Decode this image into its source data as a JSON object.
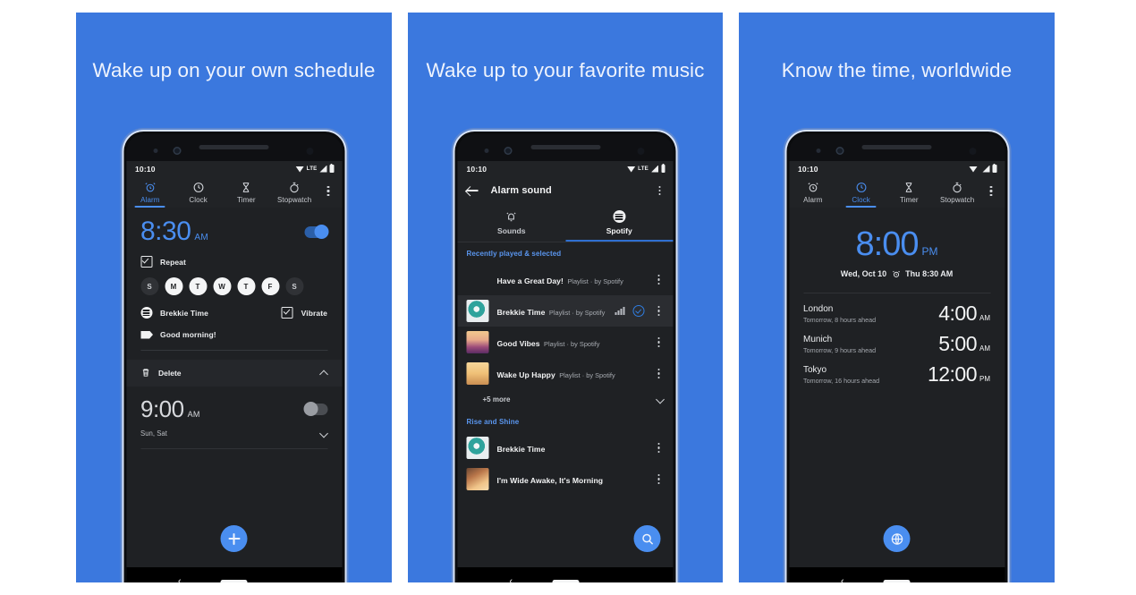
{
  "theme": {
    "bg_blue": "#3b78de",
    "accent_blue": "#4a8ef0",
    "screen_bg": "#1f2124",
    "bar_bg": "#212326",
    "page_bg": "#ffffff"
  },
  "panels": [
    {
      "headline": "Wake up on your own schedule",
      "status": {
        "time": "10:10",
        "lte": "LTE"
      },
      "tabs": [
        {
          "label": "Alarm",
          "icon": "alarm-clock-icon",
          "active": true
        },
        {
          "label": "Clock",
          "icon": "clock-icon",
          "active": false
        },
        {
          "label": "Timer",
          "icon": "hourglass-icon",
          "active": false
        },
        {
          "label": "Stopwatch",
          "icon": "stopwatch-icon",
          "active": false
        }
      ],
      "alarm1": {
        "time": "8:30",
        "meridiem": "AM",
        "enabled": true,
        "repeat_label": "Repeat",
        "repeat_checked": true,
        "days": [
          {
            "letter": "S",
            "on": false
          },
          {
            "letter": "M",
            "on": true
          },
          {
            "letter": "T",
            "on": true
          },
          {
            "letter": "W",
            "on": true
          },
          {
            "letter": "T",
            "on": true
          },
          {
            "letter": "F",
            "on": true
          },
          {
            "letter": "S",
            "on": false
          }
        ],
        "sound_label": "Brekkie Time",
        "vibrate_label": "Vibrate",
        "vibrate_checked": true,
        "message_label": "Good morning!",
        "delete_label": "Delete"
      },
      "alarm2": {
        "time": "9:00",
        "meridiem": "AM",
        "enabled": false,
        "days_label": "Sun, Sat"
      },
      "fab": "add-alarm-fab"
    },
    {
      "headline": "Wake up to your favorite music",
      "status": {
        "time": "10:10",
        "lte": "LTE"
      },
      "appbar": {
        "title": "Alarm sound",
        "back": "back-arrow-icon",
        "overflow": "overflow-menu-icon"
      },
      "sound_tabs": [
        {
          "label": "Sounds",
          "icon": "bell-icon",
          "active": false
        },
        {
          "label": "Spotify",
          "icon": "spotify-icon",
          "active": true
        }
      ],
      "sections": [
        {
          "title": "Recently played & selected",
          "tracks": [
            {
              "name": "Have a Great Day!",
              "sub": "Playlist · by Spotify",
              "art": "sunset",
              "selected": false
            },
            {
              "name": "Brekkie Time",
              "sub": "Playlist · by Spotify",
              "art": "teal-bowl",
              "selected": true
            },
            {
              "name": "Good Vibes",
              "sub": "Playlist · by Spotify",
              "art": "crowd",
              "selected": false
            },
            {
              "name": "Wake Up Happy",
              "sub": "Playlist · by Spotify",
              "art": "desert",
              "selected": false
            }
          ],
          "more_label": "+5 more"
        },
        {
          "title": "Rise and Shine",
          "tracks": [
            {
              "name": "Brekkie Time",
              "sub": "",
              "art": "teal-bowl",
              "selected": false
            },
            {
              "name": "I'm Wide Awake, It's Morning",
              "sub": "",
              "art": "warm-bed",
              "selected": false
            }
          ],
          "more_label": ""
        }
      ],
      "fab": "search-fab"
    },
    {
      "headline": "Know the time, worldwide",
      "status": {
        "time": "10:10",
        "lte": ""
      },
      "tabs": [
        {
          "label": "Alarm",
          "icon": "alarm-clock-icon",
          "active": false
        },
        {
          "label": "Clock",
          "icon": "clock-icon",
          "active": true
        },
        {
          "label": "Timer",
          "icon": "hourglass-icon",
          "active": false
        },
        {
          "label": "Stopwatch",
          "icon": "stopwatch-icon",
          "active": false
        }
      ],
      "clock": {
        "time": "8:00",
        "meridiem": "PM",
        "date": "Wed, Oct 10",
        "next_alarm": "Thu 8:30 AM"
      },
      "cities": [
        {
          "name": "London",
          "sub": "Tomorrow, 8 hours ahead",
          "time": "4:00",
          "meridiem": "AM"
        },
        {
          "name": "Munich",
          "sub": "Tomorrow, 9 hours ahead",
          "time": "5:00",
          "meridiem": "AM"
        },
        {
          "name": "Tokyo",
          "sub": "Tomorrow, 16 hours ahead",
          "time": "12:00",
          "meridiem": "PM"
        }
      ],
      "fab": "add-city-fab"
    }
  ]
}
